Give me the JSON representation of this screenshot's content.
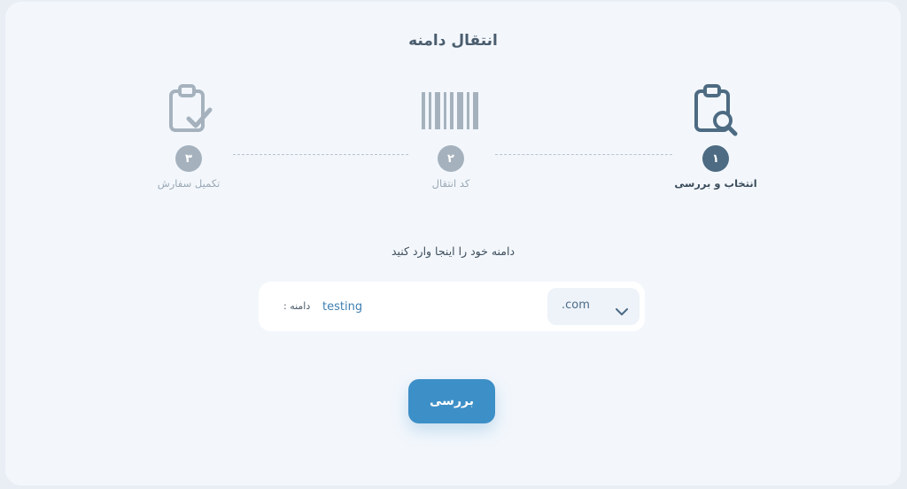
{
  "page": {
    "title": "انتقال دامنه"
  },
  "steps": [
    {
      "number": "۱",
      "label": "انتخاب و بررسی",
      "icon": "clipboard-search-icon",
      "state": "active"
    },
    {
      "number": "۲",
      "label": "کد انتقال",
      "icon": "barcode-icon",
      "state": "inactive"
    },
    {
      "number": "۳",
      "label": "تکمیل سفارش",
      "icon": "clipboard-check-icon",
      "state": "inactive"
    }
  ],
  "form": {
    "prompt": "دامنه خود را اینجا وارد کنید",
    "domain_label": "دامنه :",
    "domain_value": "testing",
    "tld_value": ".com",
    "submit_label": "بررسی"
  },
  "colors": {
    "active": "#4d6b82",
    "inactive": "#a5b2be",
    "accent": "#3d8fc7",
    "background": "#f3f7fc"
  }
}
